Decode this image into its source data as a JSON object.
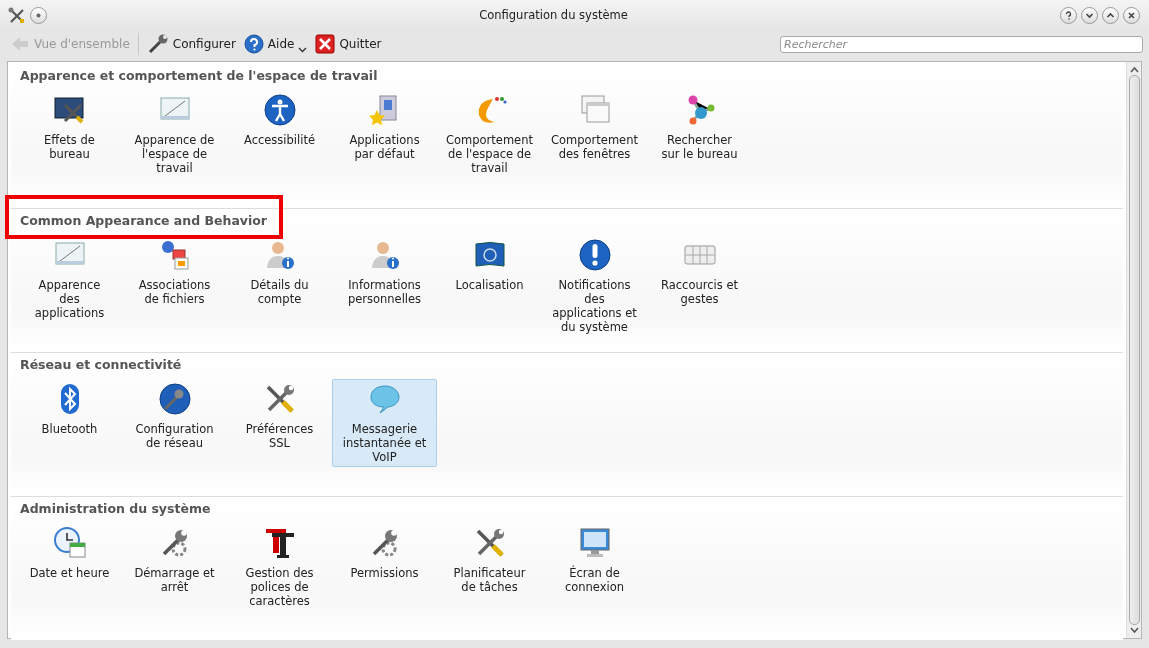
{
  "window": {
    "title": "Configuration du système"
  },
  "toolbar": {
    "items": [
      {
        "kind": "back",
        "label": "Vue d'ensemble",
        "disabled": true
      },
      {
        "kind": "configure",
        "label": "Configurer",
        "disabled": false
      },
      {
        "kind": "help",
        "label": "Aide",
        "disabled": false
      },
      {
        "kind": "quit",
        "label": "Quitter",
        "disabled": false
      }
    ],
    "search": {
      "placeholder": "Rechercher"
    }
  },
  "sections": [
    {
      "title": "Apparence et comportement de l'espace de travail",
      "highlighted": false,
      "items": [
        {
          "label": "Effets de\nbureau",
          "selected": false
        },
        {
          "label": "Apparence de\nl'espace de\ntravail",
          "selected": false
        },
        {
          "label": "Accessibilité",
          "selected": false
        },
        {
          "label": "Applications\npar défaut",
          "selected": false
        },
        {
          "label": "Comportement\nde l'espace de\ntravail",
          "selected": false
        },
        {
          "label": "Comportement\ndes fenêtres",
          "selected": false
        },
        {
          "label": "Rechercher\nsur le bureau",
          "selected": false
        }
      ]
    },
    {
      "title": "Common Appearance and Behavior",
      "highlighted": true,
      "items": [
        {
          "label": "Apparence\ndes\napplications",
          "selected": false
        },
        {
          "label": "Associations\nde fichiers",
          "selected": false
        },
        {
          "label": "Détails du\ncompte",
          "selected": false
        },
        {
          "label": "Informations\npersonnelles",
          "selected": false
        },
        {
          "label": "Localisation",
          "selected": false
        },
        {
          "label": "Notifications\ndes\napplications et\ndu système",
          "selected": false
        },
        {
          "label": "Raccourcis et\ngestes",
          "selected": false
        }
      ]
    },
    {
      "title": "Réseau et connectivité",
      "highlighted": false,
      "items": [
        {
          "label": "Bluetooth",
          "selected": false
        },
        {
          "label": "Configuration\nde réseau",
          "selected": false
        },
        {
          "label": "Préférences\nSSL",
          "selected": false
        },
        {
          "label": "Messagerie\ninstantanée et\nVoIP",
          "selected": true
        }
      ]
    },
    {
      "title": "Administration du système",
      "highlighted": false,
      "items": [
        {
          "label": "Date et heure",
          "selected": false
        },
        {
          "label": "Démarrage et\narrêt",
          "selected": false
        },
        {
          "label": "Gestion des\npolices de\ncaractères",
          "selected": false
        },
        {
          "label": "Permissions",
          "selected": false
        },
        {
          "label": "Planificateur\nde tâches",
          "selected": false
        },
        {
          "label": "Écran de\nconnexion",
          "selected": false
        }
      ]
    }
  ]
}
